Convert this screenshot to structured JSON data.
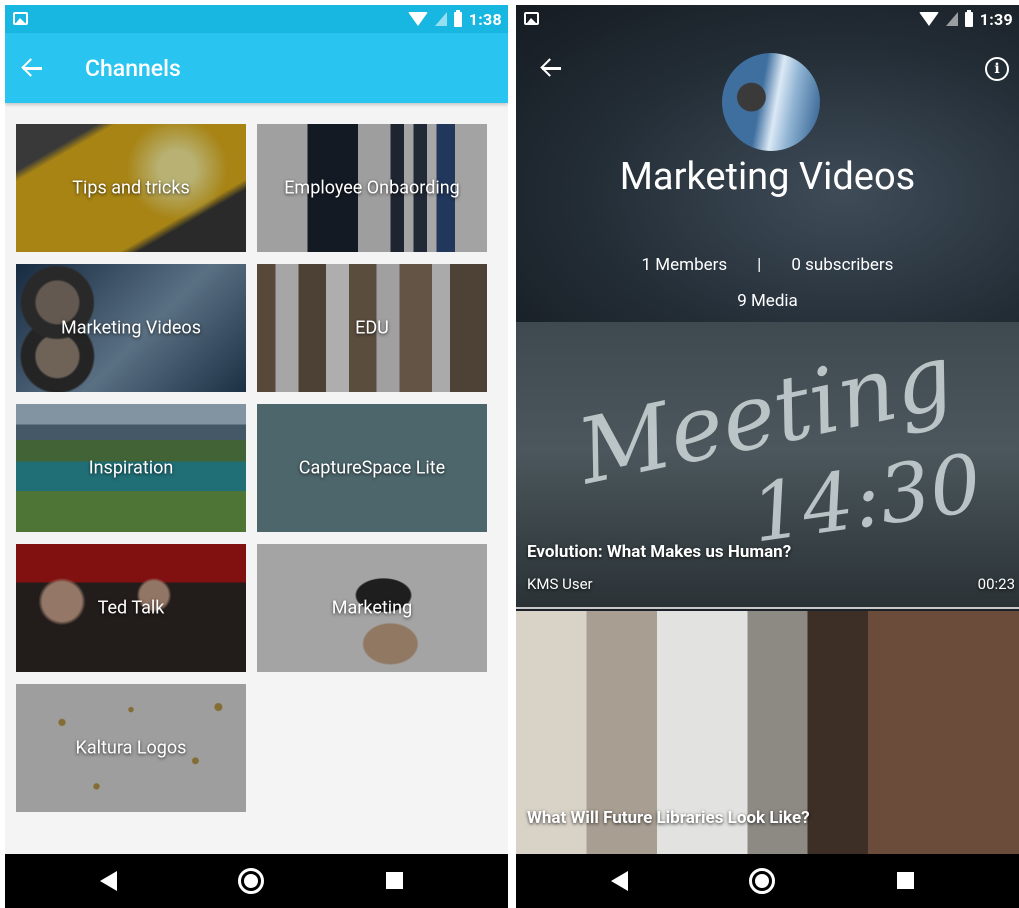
{
  "left_screen": {
    "status_bar": {
      "time": "1:38"
    },
    "app_bar": {
      "title": "Channels"
    },
    "channels": [
      {
        "label": "Tips and tricks",
        "bg": "tips"
      },
      {
        "label": "Employee Onbaording",
        "bg": "employee"
      },
      {
        "label": "Marketing Videos",
        "bg": "marketing"
      },
      {
        "label": "EDU",
        "bg": "edu"
      },
      {
        "label": "Inspiration",
        "bg": "inspiration"
      },
      {
        "label": "CaptureSpace Lite",
        "bg": "capture"
      },
      {
        "label": "Ted Talk",
        "bg": "ted"
      },
      {
        "label": "Marketing",
        "bg": "marketing2"
      },
      {
        "label": "Kaltura Logos",
        "bg": "kaltura"
      }
    ]
  },
  "right_screen": {
    "status_bar": {
      "time": "1:39"
    },
    "channel": {
      "title": "Marketing Videos",
      "members": "1 Members",
      "separator": "|",
      "subscribers": "0 subscribers",
      "media": "9 Media"
    },
    "videos": [
      {
        "title": "Evolution: What Makes us Human?",
        "owner": "KMS User",
        "duration": "00:23"
      },
      {
        "title": "What Will Future Libraries Look Like?"
      }
    ]
  },
  "colors": {
    "accent": "#29c4ef",
    "status_bar": "#18b7e2",
    "nav_bar": "#000000"
  },
  "icons": [
    "back-arrow-icon",
    "info-icon",
    "nav-back-icon",
    "nav-home-icon",
    "nav-recents-icon",
    "wifi-icon",
    "signal-icon",
    "battery-icon",
    "image-notification-icon"
  ]
}
